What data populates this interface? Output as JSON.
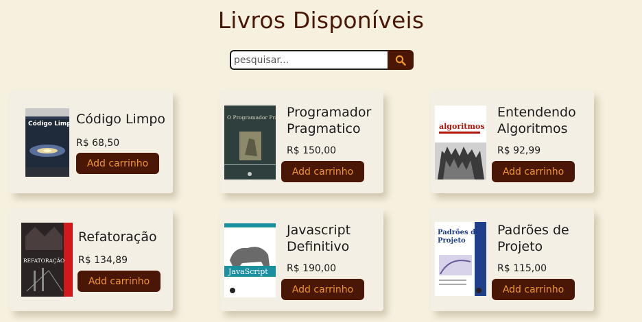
{
  "header": {
    "title": "Livros Disponíveis"
  },
  "search": {
    "placeholder": "pesquisar...",
    "icon": "search-icon"
  },
  "books": [
    {
      "title": "Código Limpo",
      "price": "R$ 68,50",
      "button": "Add carrinho",
      "cover_text": "Código Limpo"
    },
    {
      "title": "Programador Pragmatico",
      "price": "R$ 150,00",
      "button": "Add carrinho",
      "cover_text": "O Programador Pragmático"
    },
    {
      "title": "Entendendo Algoritmos",
      "price": "R$ 92,99",
      "button": "Add carrinho",
      "cover_text": "algoritmos"
    },
    {
      "title": "Refatoração",
      "price": "R$ 134,89",
      "button": "Add carrinho",
      "cover_text": "REFATORAÇÃO"
    },
    {
      "title": "Javascript Definitivo",
      "price": "R$ 190,00",
      "button": "Add carrinho",
      "cover_text": "JavaScript"
    },
    {
      "title": "Padrões de Projeto",
      "price": "R$ 115,00",
      "button": "Add carrinho",
      "cover_text": "Padrões de Projeto"
    }
  ],
  "colors": {
    "background": "#f6f1df",
    "card": "#f4efe4",
    "accent": "#4a1605",
    "button_text": "#f0962a"
  }
}
